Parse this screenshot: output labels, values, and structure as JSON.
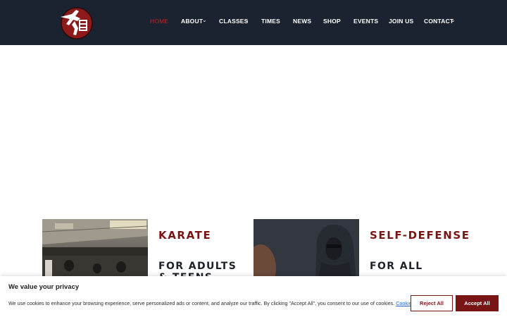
{
  "nav": {
    "items": [
      {
        "label": "HOME",
        "active": true
      },
      {
        "label": "ABOUT",
        "dropdown": true
      },
      {
        "label": "CLASSES",
        "dropdown": true
      },
      {
        "label": "TIMES"
      },
      {
        "label": "NEWS"
      },
      {
        "label": "SHOP"
      },
      {
        "label": "EVENTS"
      },
      {
        "label": "JOIN US"
      },
      {
        "label": "CONTACT",
        "dropdown": true
      }
    ],
    "dropdown_icon": "chevron-down-icon"
  },
  "logo": {
    "icon": "martial-arts-logo-icon"
  },
  "cards": [
    {
      "title": "KARATE",
      "subtitle": "FOR ADULTS & TEENS",
      "image": "karate-class-photo"
    },
    {
      "title": "SELF-DEFENSE",
      "subtitle": "FOR ALL",
      "image": "hooded-figure-photo"
    }
  ],
  "cookie_banner": {
    "title": "We value your privacy",
    "text": "We use cookies to enhance your browsing experience, serve personalized ads or content, and analyze our traffic. By clicking \"Accept All\", you consent to our use of cookies.",
    "link_label": "Cookie Policy",
    "reject_label": "Reject All",
    "accept_label": "Accept All"
  },
  "colors": {
    "header_bg": "#1b2230",
    "accent": "#7a1515",
    "active_nav": "#b02a2a",
    "link": "#1f63c6"
  }
}
